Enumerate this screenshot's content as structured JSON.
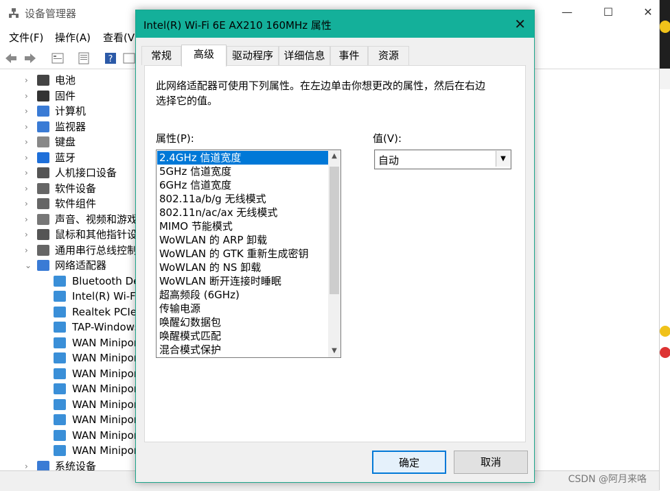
{
  "device_manager": {
    "title": "设备管理器",
    "menu": [
      "文件(F)",
      "操作(A)",
      "查看(V"
    ],
    "tree": [
      {
        "label": "电池"
      },
      {
        "label": "固件"
      },
      {
        "label": "计算机"
      },
      {
        "label": "监视器"
      },
      {
        "label": "键盘"
      },
      {
        "label": "蓝牙"
      },
      {
        "label": "人机接口设备"
      },
      {
        "label": "软件设备"
      },
      {
        "label": "软件组件"
      },
      {
        "label": "声音、视频和游戏"
      },
      {
        "label": "鼠标和其他指针设"
      },
      {
        "label": "通用串行总线控制"
      },
      {
        "label": "网络适配器"
      }
    ],
    "network_children": [
      "Bluetooth Dev",
      "Intel(R) Wi-Fi",
      "Realtek PCIe",
      "TAP-Windows",
      "WAN Minipor",
      "WAN Minipor",
      "WAN Minipor",
      "WAN Minipor",
      "WAN Minipor",
      "WAN Minipor",
      "WAN Minipor",
      "WAN Minipor"
    ],
    "last_node": "系统设备",
    "watermark": "CSDN @阿月来咯"
  },
  "dialog": {
    "title": "Intel(R) Wi-Fi 6E AX210 160MHz 属性",
    "tabs": [
      "常规",
      "高级",
      "驱动程序",
      "详细信息",
      "事件",
      "资源"
    ],
    "active_tab": "高级",
    "description": "此网络适配器可使用下列属性。在左边单击你想更改的属性，然后在右边选择它的值。",
    "property_label": "属性(P):",
    "value_label": "值(V):",
    "properties": [
      "2.4GHz 信道宽度",
      "5GHz 信道宽度",
      "6GHz 信道宽度",
      "802.11a/b/g 无线模式",
      "802.11n/ac/ax 无线模式",
      "MIMO 节能模式",
      "WoWLAN 的 ARP 卸载",
      "WoWLAN 的 GTK 重新生成密钥",
      "WoWLAN 的 NS 卸载",
      "WoWLAN 断开连接时睡眠",
      "超高频段 (6GHz)",
      "传输电源",
      "唤醒幻数据包",
      "唤醒模式匹配",
      "混合模式保护"
    ],
    "selected_property": "2.4GHz 信道宽度",
    "value": "自动",
    "ok": "确定",
    "cancel": "取消"
  },
  "colors": {
    "title_bar": "#14b09a",
    "selection": "#0078d7"
  }
}
